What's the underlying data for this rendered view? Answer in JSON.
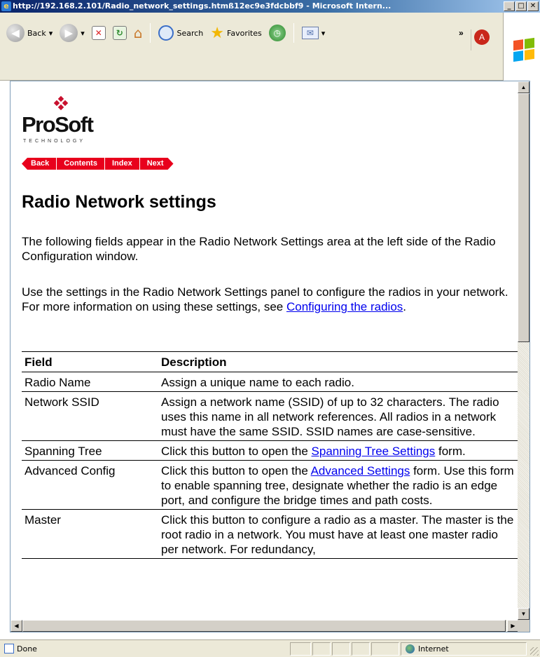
{
  "window": {
    "title": "http://192.168.2.101/Radio_network_settings.htmß12ec9e3fdcbbf9 - Microsoft Intern...",
    "buttons": {
      "minimize": "_",
      "maximize": "□",
      "close": "✕"
    }
  },
  "toolbar": {
    "back_label": "Back",
    "search_label": "Search",
    "favorites_label": "Favorites",
    "more_chevron": "»"
  },
  "page": {
    "logo": {
      "word": "ProSoft",
      "sub": "TECHNOLOGY"
    },
    "nav": [
      "Back",
      "Contents",
      "Index",
      "Next"
    ],
    "heading": "Radio Network settings",
    "para1": "The following fields appear in the Radio Network Settings area at the left side of the Radio Configuration window.",
    "para2_text": "Use the settings in the Radio Network Settings panel to configure the radios in your network. For more information on using these settings, see ",
    "para2_link": "Configuring the radios",
    "para2_end": ".",
    "table": {
      "headers": [
        "Field",
        "Description"
      ],
      "rows": [
        {
          "field": "Radio Name",
          "desc_before": "Assign a unique name to each radio.",
          "link": "",
          "desc_after": ""
        },
        {
          "field": "Network SSID",
          "desc_before": "Assign a network name (SSID) of up to 32 characters. The radio uses this name in all network references. All radios in a network must have the same SSID. SSID names are case-sensitive.",
          "link": "",
          "desc_after": ""
        },
        {
          "field": "Spanning Tree",
          "desc_before": "Click this button to open the ",
          "link": "Spanning Tree Settings",
          "desc_after": " form."
        },
        {
          "field": "Advanced Config",
          "desc_before": "Click this button to open the ",
          "link": "Advanced Settings",
          "desc_after": " form. Use this form to enable spanning tree, designate whether the radio is an edge port, and configure the bridge times and path costs."
        },
        {
          "field": "Master",
          "desc_before": "Click this button to configure a radio as a master. The master is the root radio in a network. You must have at least one master radio per network. For redundancy,",
          "link": "",
          "desc_after": ""
        }
      ]
    }
  },
  "statusbar": {
    "status": "Done",
    "zone": "Internet"
  },
  "colors": {
    "nav_red": "#e8001c",
    "link_blue": "#0000ee",
    "logo_red": "#c8102e"
  }
}
